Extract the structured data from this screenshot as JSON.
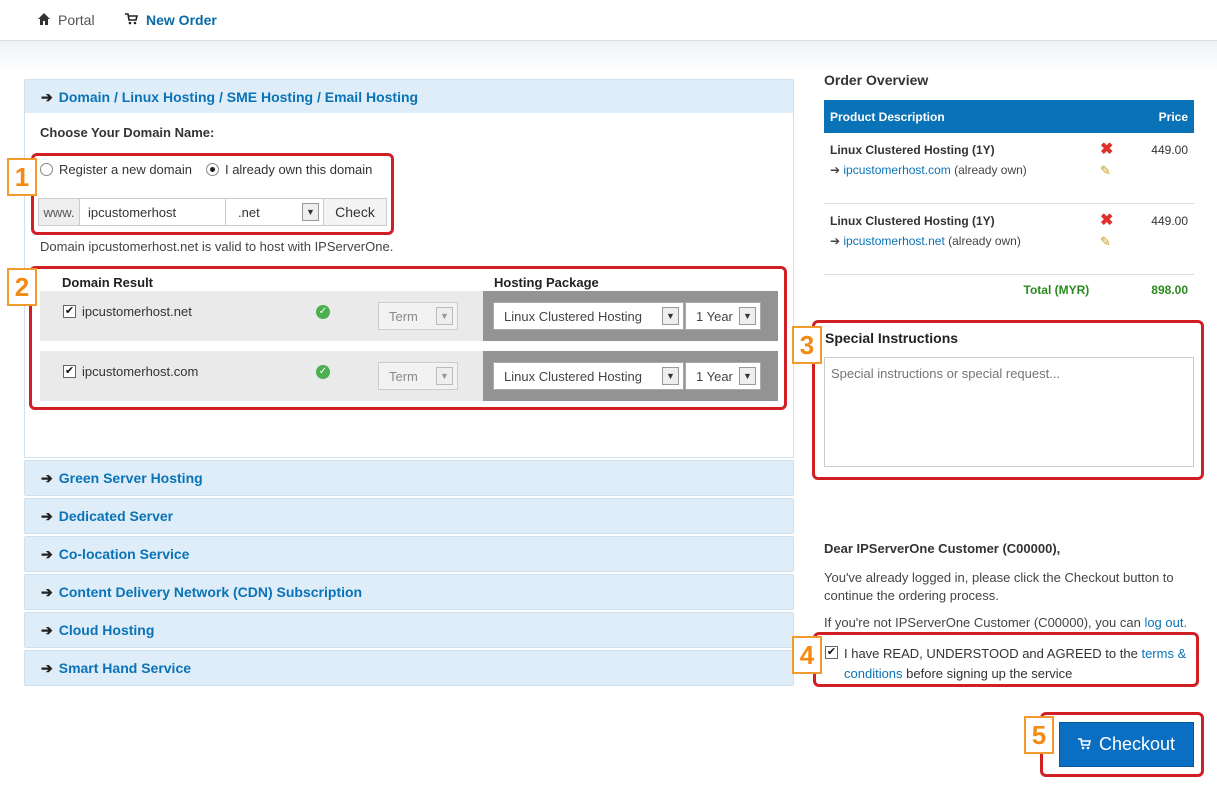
{
  "nav": {
    "portal": "Portal",
    "new_order": "New Order"
  },
  "sections": {
    "domain_linux": "Domain / Linux Hosting / SME Hosting / Email Hosting",
    "green": "Green Server Hosting",
    "dedicated": "Dedicated Server",
    "colocation": "Co-location Service",
    "cdn": "Content Delivery Network (CDN) Subscription",
    "cloud": "Cloud Hosting",
    "smart_hand": "Smart Hand Service"
  },
  "domain_form": {
    "heading": "Choose Your Domain Name:",
    "option_register": "Register a new domain",
    "option_own": "I already own this domain",
    "prefix": "www.",
    "domain_value": "ipcustomerhost",
    "tld": ".net",
    "check_label": "Check",
    "valid_message": "Domain ipcustomerhost.net is valid to host with IPServerOne."
  },
  "results": {
    "col_domain": "Domain Result",
    "col_package": "Hosting Package",
    "rows": [
      {
        "domain": "ipcustomerhost.net",
        "term": "Term",
        "package": "Linux Clustered Hosting",
        "period": "1 Year"
      },
      {
        "domain": "ipcustomerhost.com",
        "term": "Term",
        "package": "Linux Clustered Hosting",
        "period": "1 Year"
      }
    ]
  },
  "order": {
    "title": "Order Overview",
    "col_desc": "Product Description",
    "col_price": "Price",
    "items": [
      {
        "name": "Linux Clustered Hosting (1Y)",
        "domain": "ipcustomerhost.com",
        "note": "(already own)",
        "price": "449.00"
      },
      {
        "name": "Linux Clustered Hosting (1Y)",
        "domain": "ipcustomerhost.net",
        "note": "(already own)",
        "price": "449.00"
      }
    ],
    "total_label": "Total (MYR)",
    "total_value": "898.00"
  },
  "instructions": {
    "title": "Special Instructions",
    "placeholder": "Special instructions or special request..."
  },
  "customer": {
    "dear": "Dear IPServerOne Customer (C00000),",
    "logged_in": "You've already logged in, please click the Checkout button to continue the ordering process.",
    "not_customer": "If you're not IPServerOne Customer (C00000), you can",
    "logout": "log out."
  },
  "terms": {
    "pre": "I have READ, UNDERSTOOD and AGREED to the",
    "link": "terms & conditions",
    "post": "before signing up the service"
  },
  "checkout_label": "Checkout",
  "callouts": [
    "1",
    "2",
    "3",
    "4",
    "5"
  ],
  "colors": {
    "accent": "#0a73b7",
    "callout_border": "#d11f26",
    "badge": "#f38a12",
    "total_green": "#2a8a1e"
  }
}
